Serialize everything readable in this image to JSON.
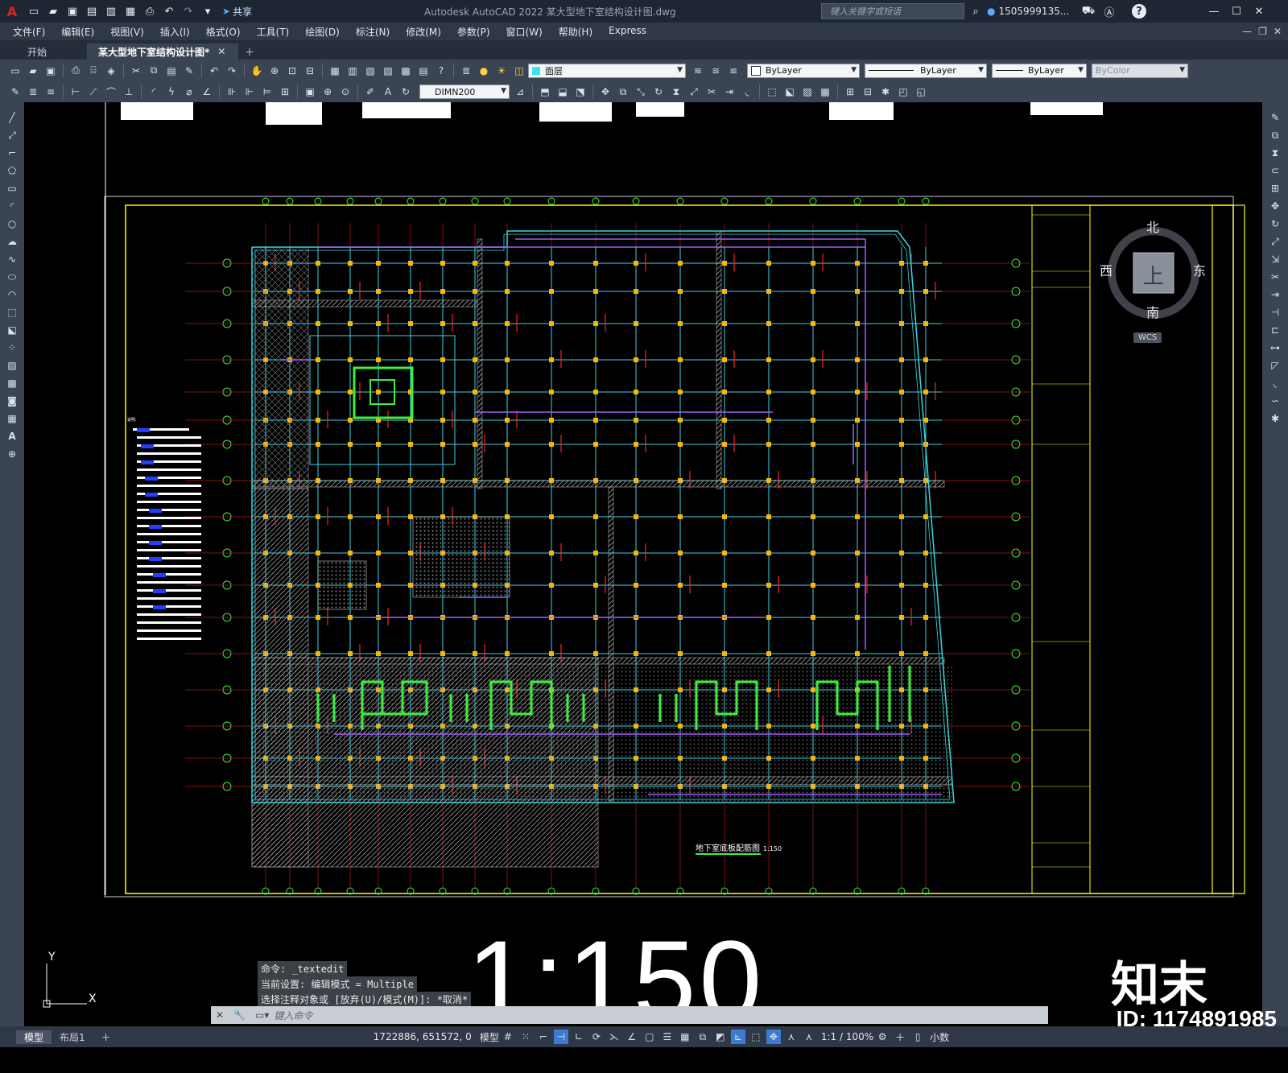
{
  "titlebar": {
    "app_logo": "A",
    "share_label": "共享",
    "title": "Autodesk AutoCAD 2022    某大型地下室结构设计图.dwg",
    "search_placeholder": "键入关键字或短语",
    "user": "1505999135...",
    "help": "?"
  },
  "menu": [
    "文件(F)",
    "编辑(E)",
    "视图(V)",
    "插入(I)",
    "格式(O)",
    "工具(T)",
    "绘图(D)",
    "标注(N)",
    "修改(M)",
    "参数(P)",
    "窗口(W)",
    "帮助(H)",
    "Express"
  ],
  "tabs": [
    {
      "label": "开始"
    },
    {
      "label": "某大型地下室结构设计图*"
    }
  ],
  "toolbar": {
    "layer_value": "面层",
    "color_value": "ByLayer",
    "linetype_value": "ByLayer",
    "lineweight_value": "ByLayer",
    "plotstyle_value": "ByColor",
    "dimstyle_value": "DIMN200"
  },
  "viewcube": {
    "north": "北",
    "south": "南",
    "east": "东",
    "west": "西",
    "top": "上",
    "wcs": "WCS"
  },
  "drawing": {
    "plan_title": "地下室底板配筋图",
    "plan_scale": "1:150",
    "big_scale": "1:150"
  },
  "command": {
    "history": [
      "命令: _textedit",
      "当前设置: 编辑模式 = Multiple",
      "选择注释对象或 [放弃(U)/模式(M)]: *取消*"
    ],
    "placeholder": "键入命令"
  },
  "watermark": {
    "logo": "知末",
    "id": "ID: 1174891985"
  },
  "status": {
    "model_tab": "模型",
    "layout_tab": "布局1",
    "coords": "1722886, 651572, 0",
    "model_label": "模型",
    "scale": "1:1 / 100%",
    "units": "小数"
  },
  "axis": {
    "x": "X",
    "y": "Y"
  }
}
